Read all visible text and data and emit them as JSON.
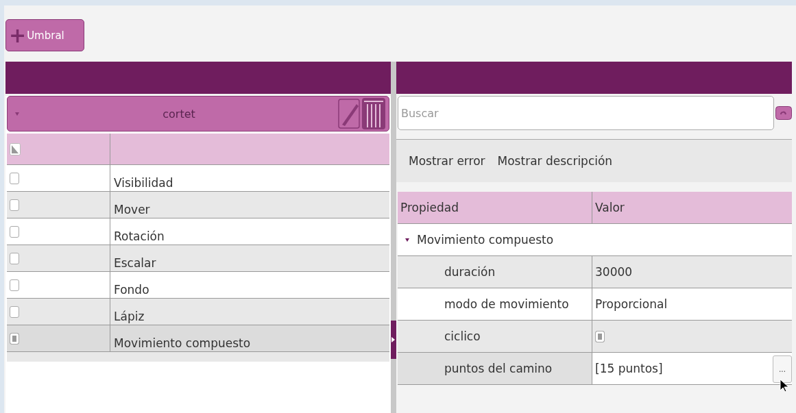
{
  "toolbar": {
    "add_button": {
      "icon": "+",
      "label": "Umbral"
    }
  },
  "layers_panel": {
    "group": {
      "title": "cortet",
      "expanded": true
    },
    "header": {
      "check_all_indeterminate": true
    },
    "rows": [
      {
        "label": "Visibilidad",
        "checked": false,
        "selected": false
      },
      {
        "label": "Mover",
        "checked": false,
        "selected": false
      },
      {
        "label": "Rotación",
        "checked": false,
        "selected": false
      },
      {
        "label": "Escalar",
        "checked": false,
        "selected": false
      },
      {
        "label": "Fondo",
        "checked": false,
        "selected": false
      },
      {
        "label": "Lápiz",
        "checked": false,
        "selected": false
      },
      {
        "label": "Movimiento compuesto",
        "checked": true,
        "selected": true
      }
    ]
  },
  "properties_panel": {
    "search": {
      "placeholder": "Buscar"
    },
    "options": [
      "Mostrar error",
      "Mostrar descripción"
    ],
    "columns": [
      "Propiedad",
      "Valor"
    ],
    "group": {
      "label": "Movimiento compuesto",
      "expanded": true,
      "children": [
        {
          "kind": "text",
          "name": "duración",
          "value": "30000"
        },
        {
          "kind": "text",
          "name": "modo de movimiento",
          "value": "Proporcional"
        },
        {
          "kind": "checkbox",
          "name": "ciclico",
          "checked": true
        },
        {
          "kind": "list",
          "name": "puntos del camino",
          "value": "[15 puntos]",
          "button": "..."
        }
      ]
    }
  }
}
